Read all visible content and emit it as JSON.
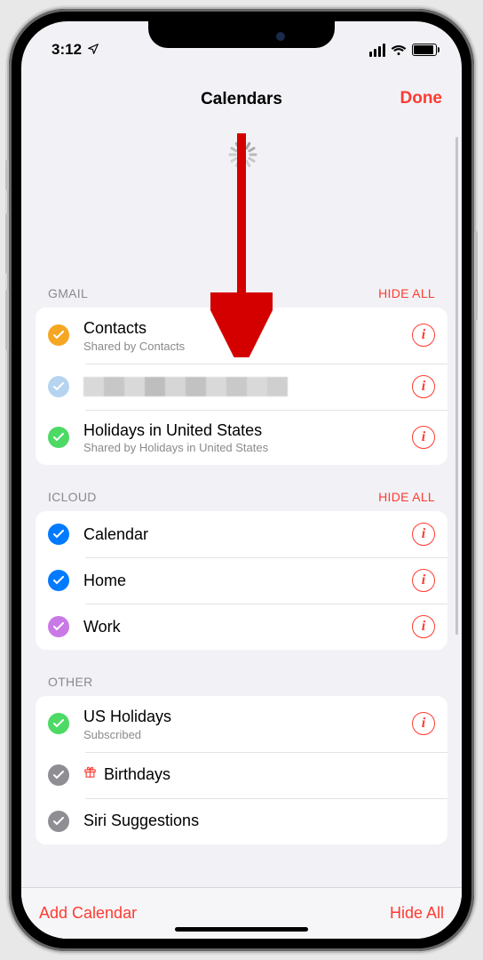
{
  "status": {
    "time": "3:12",
    "nav_icon": "location-arrow"
  },
  "modal": {
    "title": "Calendars",
    "done": "Done"
  },
  "colors": {
    "accent_red": "#ff3b30",
    "amber": "#f5a623",
    "lightblue": "#b6d4ef",
    "green": "#4cd964",
    "blue": "#007aff",
    "purple": "#c979e6",
    "slate": "#8e8e93"
  },
  "sections": [
    {
      "label": "GMAIL",
      "hide": "HIDE ALL",
      "items": [
        {
          "title": "Contacts",
          "sub": "Shared by Contacts",
          "color": "amber",
          "info": true
        },
        {
          "title": "",
          "sub": "",
          "color": "lightblue",
          "info": true,
          "redacted": true
        },
        {
          "title": "Holidays in United States",
          "sub": "Shared by Holidays in United States",
          "color": "green",
          "info": true
        }
      ]
    },
    {
      "label": "ICLOUD",
      "hide": "HIDE ALL",
      "items": [
        {
          "title": "Calendar",
          "color": "blue",
          "info": true
        },
        {
          "title": "Home",
          "color": "blue",
          "info": true
        },
        {
          "title": "Work",
          "color": "purple",
          "info": true
        }
      ]
    },
    {
      "label": "OTHER",
      "items": [
        {
          "title": "US Holidays",
          "sub": "Subscribed",
          "color": "green",
          "info": true
        },
        {
          "title": "Birthdays",
          "color": "slate",
          "gift": true
        },
        {
          "title": "Siri Suggestions",
          "color": "slate"
        }
      ]
    }
  ],
  "toolbar": {
    "add": "Add Calendar",
    "hide_all": "Hide All"
  }
}
